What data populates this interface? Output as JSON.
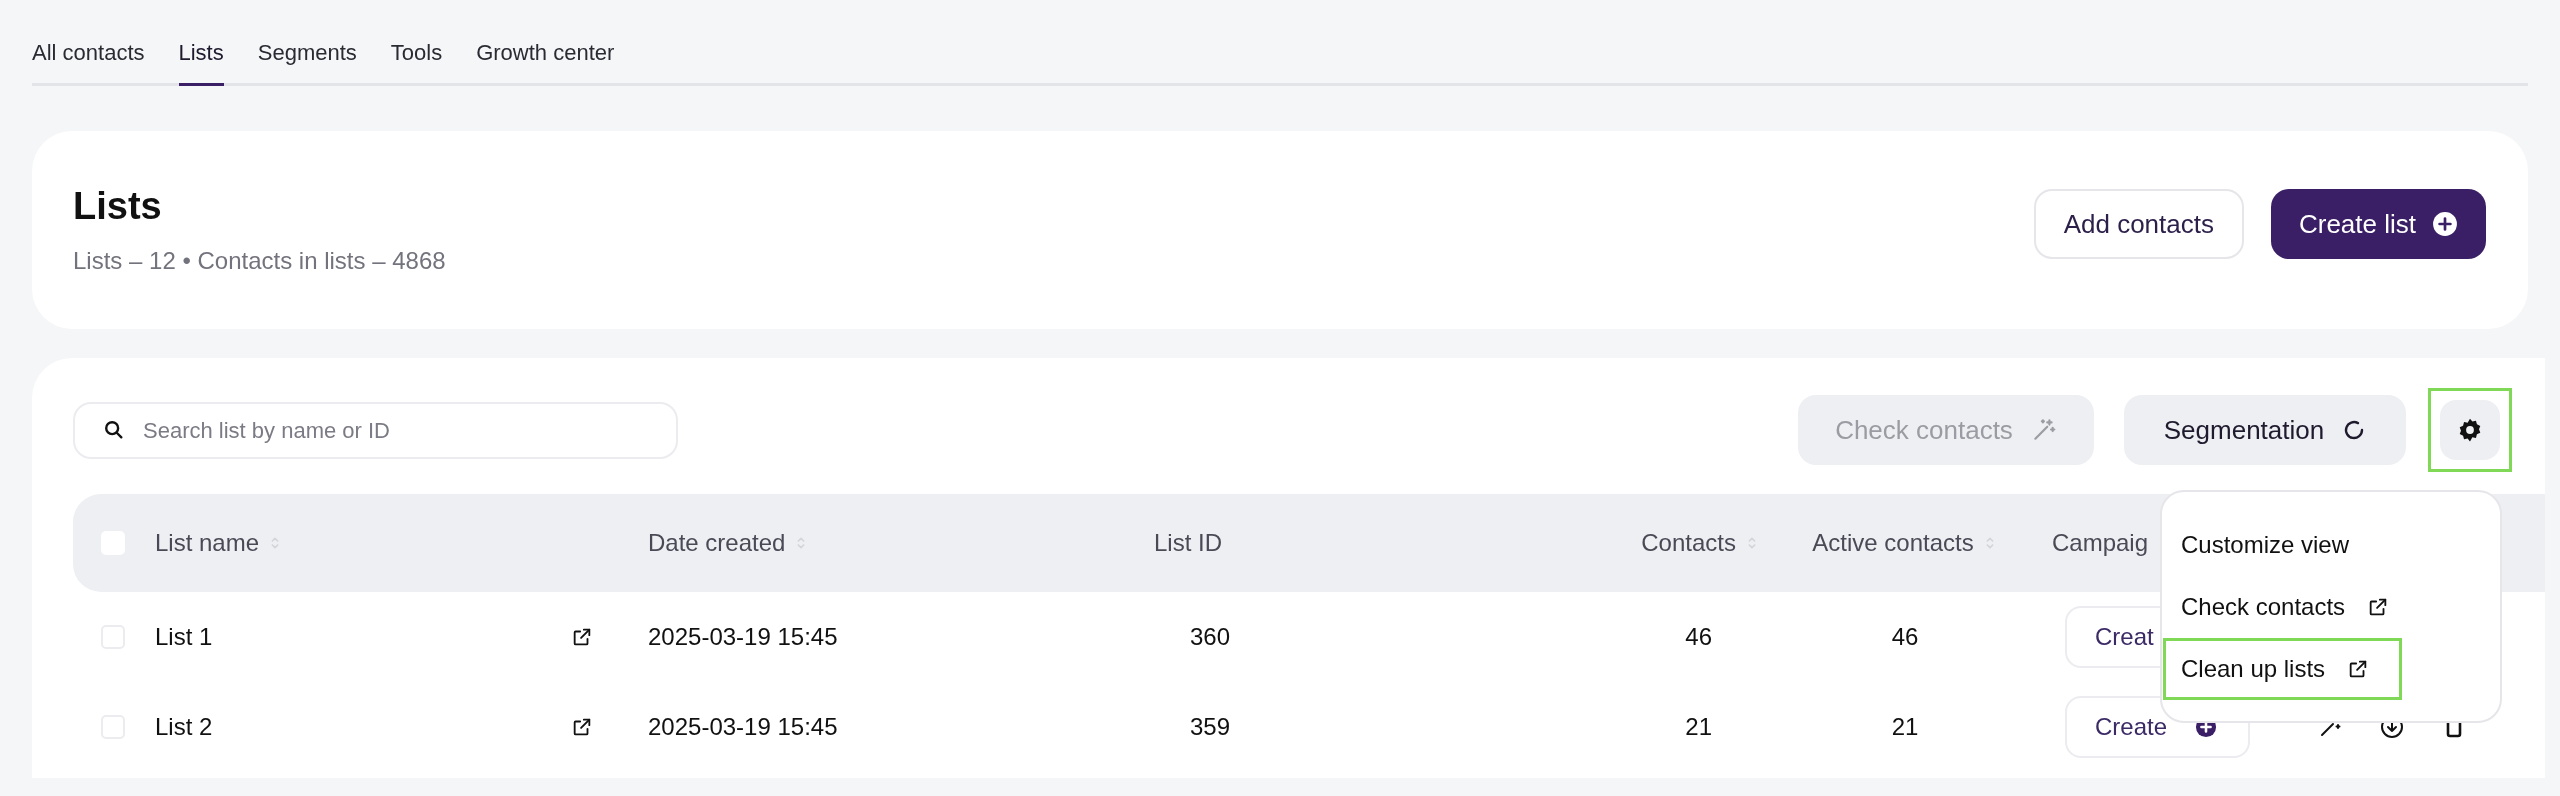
{
  "tabs": [
    {
      "label": "All contacts",
      "selected": false
    },
    {
      "label": "Lists",
      "selected": true
    },
    {
      "label": "Segments",
      "selected": false
    },
    {
      "label": "Tools",
      "selected": false
    },
    {
      "label": "Growth center",
      "selected": false
    }
  ],
  "header": {
    "title": "Lists",
    "subtitle": "Lists – 12 • Contacts in lists – 4868",
    "buttons": [
      {
        "label": "Add contacts",
        "kind": "outline"
      },
      {
        "label": "Create list",
        "kind": "primary"
      }
    ]
  },
  "toolbar": {
    "search": {
      "placeholder": "Search list by name or ID"
    },
    "check_contacts": {
      "label": "Check contacts",
      "disabled": true
    },
    "segmentation": {
      "label": "Segmentation"
    },
    "settings": {
      "highlighted": true
    }
  },
  "table": {
    "select_all": {
      "checked": false
    },
    "columns": [
      {
        "label": "List name",
        "sortable": true
      },
      {
        "label": "Date created",
        "sortable": true
      },
      {
        "label": "List ID",
        "sortable": false
      },
      {
        "label": "Contacts",
        "sortable": true
      },
      {
        "label": "Active contacts",
        "sortable": true
      },
      {
        "label": "Campaig"
      }
    ],
    "rows": [
      {
        "checked": false,
        "name": "List 1",
        "date": "2025-03-19 15:45",
        "id": "360",
        "contacts": "46",
        "active_contacts": "46",
        "campaign": {
          "label": "Creat"
        }
      },
      {
        "checked": false,
        "name": "List 2",
        "date": "2025-03-19 15:45",
        "id": "359",
        "contacts": "21",
        "active_contacts": "21",
        "campaign": {
          "label": "Create",
          "plus_icon": true
        }
      }
    ]
  },
  "menu": {
    "items": [
      {
        "label": "Customize view",
        "external": false,
        "highlighted": false
      },
      {
        "label": "Check contacts",
        "external": true,
        "highlighted": false
      },
      {
        "label": "Clean up lists",
        "external": true,
        "highlighted": true
      }
    ]
  }
}
